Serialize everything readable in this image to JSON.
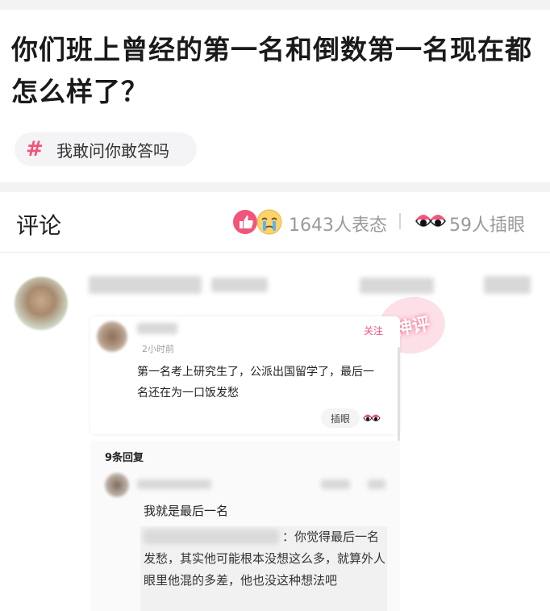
{
  "post": {
    "title": "你们班上曾经的第一名和倒数第一名现在都怎么样了？",
    "tag_symbol": "#",
    "tag_label": "我敢问你敢答吗"
  },
  "comments_header": {
    "label": "评论",
    "reactions_text": "1643人表态",
    "peek_text": "59人插眼"
  },
  "comment": {
    "follow_label": "关注",
    "time": "2小时前",
    "text": "第一名考上研究生了，公派出国留学了，最后一名还在为一口饭发愁",
    "peek_button": "插眼",
    "stamp_text": "神评"
  },
  "replies": {
    "count_label": "9条回复",
    "first_reply": "我就是最后一名",
    "quoted_reply": "：你觉得最后一名发愁，其实他可能根本没想这么多，就算外人眼里他混的多差，他也没这种想法吧"
  },
  "colors": {
    "accent_pink": "#f2557a",
    "muted_gray": "#9a9a9a",
    "separator": "#f3f3f3"
  }
}
